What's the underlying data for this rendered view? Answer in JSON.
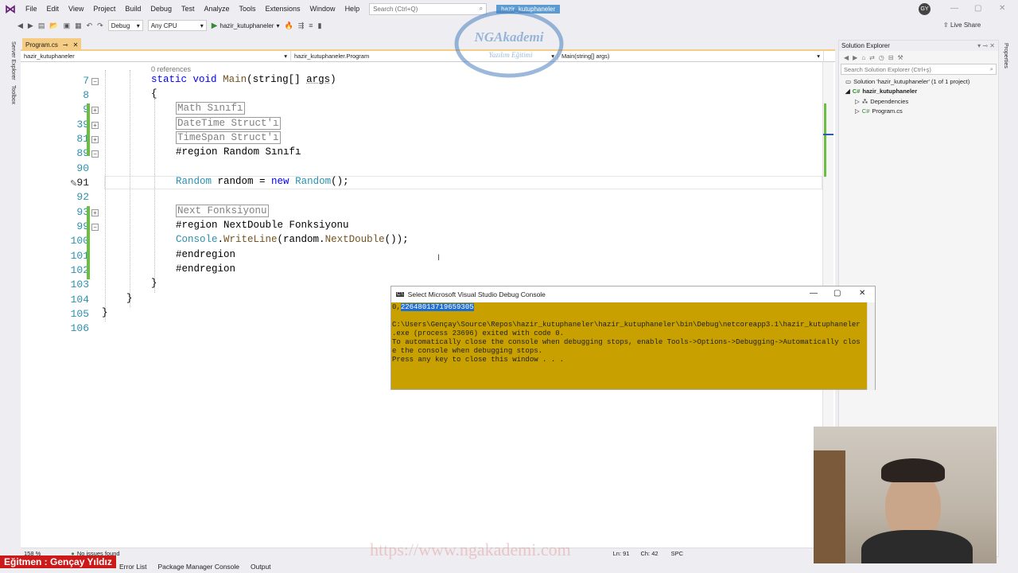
{
  "menu": [
    "File",
    "Edit",
    "View",
    "Project",
    "Build",
    "Debug",
    "Test",
    "Analyze",
    "Tools",
    "Extensions",
    "Window",
    "Help"
  ],
  "search_placeholder": "Search (Ctrl+Q)",
  "solution_name": "hazir_kutuphaneler",
  "user_initials": "GY",
  "toolbar": {
    "config": "Debug",
    "platform": "Any CPU",
    "run_target": "hazir_kutuphaneler",
    "live_share": "Live Share"
  },
  "left_rail": [
    "Server Explorer",
    "Toolbox"
  ],
  "right_rail": "Properties",
  "doc_tab": "Program.cs",
  "nav": {
    "project": "hazir_kutuphaneler",
    "class": "hazir_kutuphaneler.Program",
    "member": "Main(string[] args)"
  },
  "references": "0 references",
  "lines": [
    "7",
    "8",
    "9",
    "39",
    "81",
    "89",
    "90",
    "91",
    "92",
    "93",
    "99",
    "100",
    "101",
    "102",
    "103",
    "104",
    "105",
    "106"
  ],
  "code": {
    "l7_kw1": "static",
    "l7_kw2": "void",
    "l7_name": "Main",
    "l7_rest": "(string[] ",
    "l7_arg": "args",
    "l7_end": ")",
    "l8": "{",
    "l9": "Math Sınıfı",
    "l39": "DateTime Struct'ı",
    "l81": "TimeSpan Struct'ı",
    "l89": "#region Random Sınıfı",
    "l91_t1": "Random",
    "l91_v": " random = ",
    "l91_new": "new",
    "l91_t2": "Random",
    "l91_end": "();",
    "l93": "Next Fonksiyonu",
    "l99": "#region NextDouble Fonksiyonu",
    "l100_c": "Console",
    "l100_d": ".",
    "l100_m": "WriteLine",
    "l100_r": "(random.",
    "l100_m2": "NextDouble",
    "l100_e": "());",
    "l101": "#endregion",
    "l102": "#endregion",
    "l103": "}",
    "l104": "}",
    "l105": "}"
  },
  "solution_explorer": {
    "title": "Solution Explorer",
    "search": "Search Solution Explorer (Ctrl+ş)",
    "items": [
      "Solution 'hazir_kutuphaneler' (1 of 1 project)",
      "hazir_kutuphaneler",
      "Dependencies",
      "Program.cs"
    ]
  },
  "console": {
    "title": "Select Microsoft Visual Studio Debug Console",
    "output_prefix": "0,",
    "output_selected": "22648013719659305",
    "lines": [
      "C:\\Users\\Gençay\\Source\\Repos\\hazir_kutuphaneler\\hazir_kutuphaneler\\bin\\Debug\\netcoreapp3.1\\hazir_kutuphaneler",
      ".exe (process 23696) exited with code 0.",
      "To automatically close the console when debugging stops, enable Tools->Options->Debugging->Automatically clos",
      "e the console when debugging stops.",
      "Press any key to close this window . . ."
    ]
  },
  "status": {
    "zoom": "158 %",
    "issues": "No issues found",
    "line": "Ln: 91",
    "col": "Ch: 42",
    "mode": "SPC"
  },
  "bottom_tabs": [
    "Error List",
    "Package Manager Console",
    "Output"
  ],
  "instructor": "Eğitmen : Gençay Yıldız",
  "watermark": {
    "brand": "NGAkademi",
    "sub": "Yazılım Eğitimi",
    "url": "https://www.ngakademi.com"
  }
}
